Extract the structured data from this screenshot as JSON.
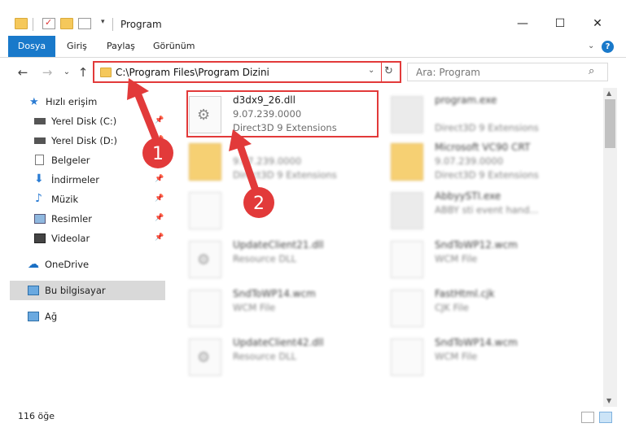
{
  "window": {
    "title": "Program",
    "minimize": "—",
    "maximize": "☐",
    "close": "✕"
  },
  "ribbon": {
    "tabs": [
      "Dosya",
      "Giriş",
      "Paylaş",
      "Görünüm"
    ],
    "help": "?"
  },
  "nav": {
    "back": "←",
    "forward": "→",
    "recent": "⌄",
    "up": "↑",
    "address": "C:\\Program Files\\Program Dizini",
    "search_placeholder": "Ara: Program"
  },
  "sidebar": {
    "items": [
      {
        "label": "Hızlı erişim",
        "icon": "star-icon",
        "pinned": false
      },
      {
        "label": "Yerel Disk (C:)",
        "icon": "drive-icon",
        "pinned": true
      },
      {
        "label": "Yerel Disk (D:)",
        "icon": "drive-icon",
        "pinned": true
      },
      {
        "label": "Belgeler",
        "icon": "documents-icon",
        "pinned": true
      },
      {
        "label": "İndirmeler",
        "icon": "download-icon",
        "pinned": true
      },
      {
        "label": "Müzik",
        "icon": "music-icon",
        "pinned": true
      },
      {
        "label": "Resimler",
        "icon": "pictures-icon",
        "pinned": true
      },
      {
        "label": "Videolar",
        "icon": "video-icon",
        "pinned": true
      },
      {
        "label": "OneDrive",
        "icon": "cloud-icon",
        "pinned": false
      },
      {
        "label": "Bu bilgisayar",
        "icon": "computer-icon",
        "pinned": false
      },
      {
        "label": "Ağ",
        "icon": "network-icon",
        "pinned": false
      }
    ]
  },
  "files": [
    {
      "name": "d3dx9_26.dll",
      "line2": "9.07.239.0000",
      "line3": "Direct3D 9 Extensions",
      "icon": "gear"
    },
    {
      "name": "program.exe",
      "line2": "",
      "line3": "Direct3D 9 Extensions",
      "icon": "exe"
    },
    {
      "name": "",
      "line2": "9.07.239.0000",
      "line3": "Direct3D 9 Extensions",
      "icon": "folder"
    },
    {
      "name": "Microsoft VC90 CRT",
      "line2": "9.07.239.0000",
      "line3": "Direct3D 9 Extensions",
      "icon": "folder"
    },
    {
      "name": "",
      "line2": "",
      "line3": "",
      "icon": "doc"
    },
    {
      "name": "AbbyySTI.exe",
      "line2": "ABBY sti event hand...",
      "line3": "",
      "icon": "exe"
    },
    {
      "name": "UpdateClient21.dll",
      "line2": "Resource DLL",
      "line3": "",
      "icon": "gear"
    },
    {
      "name": "SndToWP12.wcm",
      "line2": "WCM File",
      "line3": "",
      "icon": "doc"
    },
    {
      "name": "SndToWP14.wcm",
      "line2": "WCM File",
      "line3": "",
      "icon": "doc"
    },
    {
      "name": "FastHtml.cjk",
      "line2": "CJK File",
      "line3": "",
      "icon": "doc"
    },
    {
      "name": "UpdateClient42.dll",
      "line2": "Resource DLL",
      "line3": "",
      "icon": "gear"
    },
    {
      "name": "SndToWP14.wcm",
      "line2": "WCM File",
      "line3": "",
      "icon": "doc"
    }
  ],
  "status": {
    "count": "116 öğe"
  },
  "annotations": {
    "step1": "1",
    "step2": "2",
    "color": "#e23a3a"
  }
}
